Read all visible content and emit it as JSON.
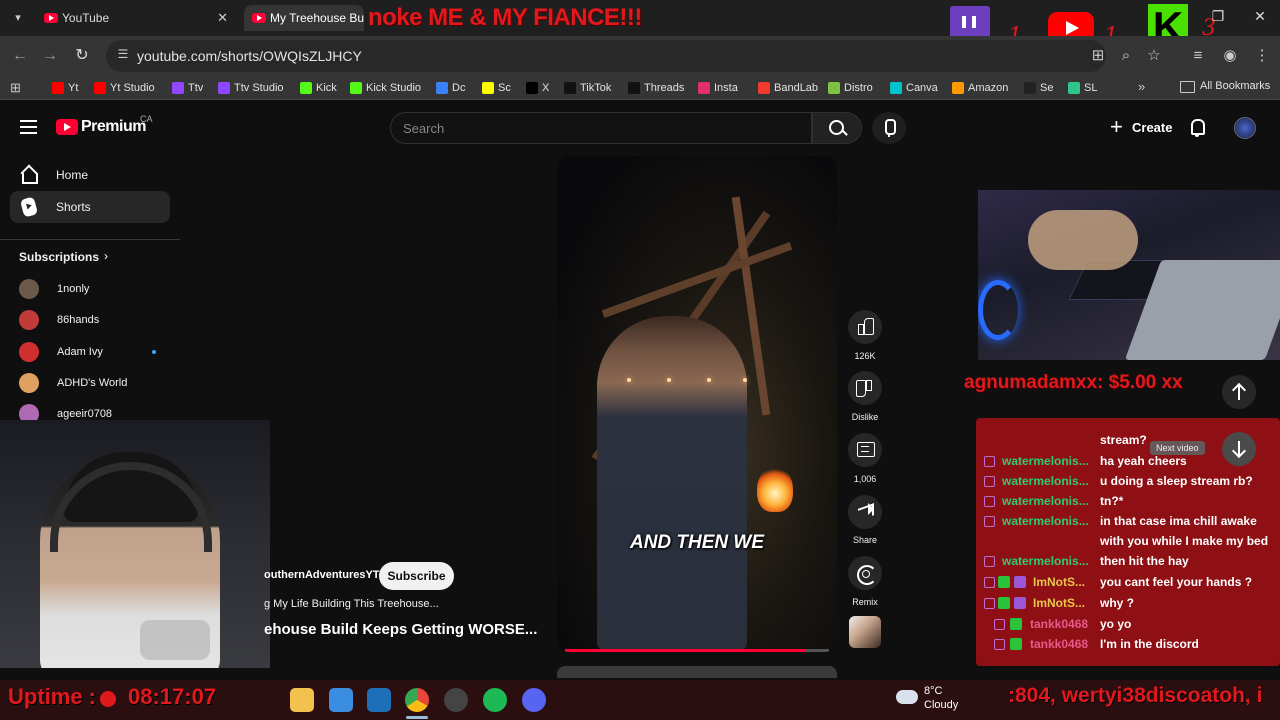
{
  "browser": {
    "tabs": [
      {
        "label": "YouTube"
      },
      {
        "label": "My Treehouse Build K"
      }
    ],
    "url": "youtube.com/shorts/OWQIsZLJHCY",
    "bookmarks": [
      {
        "label": "Yt",
        "color": "#ff0000"
      },
      {
        "label": "Yt Studio",
        "color": "#ff0000"
      },
      {
        "label": "Ttv",
        "color": "#9146ff"
      },
      {
        "label": "Ttv Studio",
        "color": "#9146ff"
      },
      {
        "label": "Kick",
        "color": "#53fc18"
      },
      {
        "label": "Kick Studio",
        "color": "#53fc18"
      },
      {
        "label": "Dc",
        "color": "#3b82f6"
      },
      {
        "label": "Sc",
        "color": "#fffc00"
      },
      {
        "label": "X",
        "color": "#000000"
      },
      {
        "label": "TikTok",
        "color": "#111111"
      },
      {
        "label": "Threads",
        "color": "#111111"
      },
      {
        "label": "Insta",
        "color": "#e1306c"
      },
      {
        "label": "BandLab",
        "color": "#f03a2e"
      },
      {
        "label": "Distro",
        "color": "#7fc241"
      },
      {
        "label": "Canva",
        "color": "#00c4cc"
      },
      {
        "label": "Amazon",
        "color": "#ff9900"
      },
      {
        "label": "Se",
        "color": "#222222"
      },
      {
        "label": "SL",
        "color": "#31c48d"
      }
    ],
    "all_bookmarks": "All Bookmarks"
  },
  "overlay": {
    "title": "noke ME & MY FIANCE!!!",
    "counts": [
      "1",
      "1",
      "3"
    ],
    "donation": "agnumadamxx: $5.00 xx",
    "uptime_label": "Uptime :",
    "uptime_value": "08:17:07",
    "ticker": ":804, wertyi38discoatoh, i"
  },
  "youtube": {
    "brand": "Premium",
    "region": "CA",
    "search_placeholder": "Search",
    "create_label": "Create",
    "sidebar": {
      "items": [
        {
          "label": "Home"
        },
        {
          "label": "Shorts"
        }
      ],
      "subscriptions_title": "Subscriptions",
      "subscriptions": [
        {
          "label": "1nonly",
          "color": "#6b5a4a"
        },
        {
          "label": "86hands",
          "color": "#c23b3b"
        },
        {
          "label": "Adam Ivy",
          "color": "#d12f2f"
        },
        {
          "label": "ADHD's World",
          "color": "#e0a060"
        },
        {
          "label": "ageeir0708",
          "color": "#b06ab3"
        }
      ]
    },
    "short": {
      "caption": "AND THEN WE",
      "progress": 0.91,
      "channel": "outhernAdventuresYT",
      "subscribe_label": "Subscribe",
      "sound": "g My Life Building This Treehouse...",
      "title": "ehouse Build Keeps Getting WORSE...",
      "actions": [
        {
          "label": "126K"
        },
        {
          "label": "Dislike"
        },
        {
          "label": "1,006"
        },
        {
          "label": "Share"
        },
        {
          "label": "Remix"
        }
      ]
    },
    "next_video_tooltip": "Next video"
  },
  "chat": {
    "top_message": "stream?",
    "messages": [
      {
        "user": "watermelonis...",
        "text": "ha yeah cheers",
        "user_color": "#2ecc71"
      },
      {
        "user": "watermelonis...",
        "text": "u doing a sleep stream rb?",
        "user_color": "#2ecc71"
      },
      {
        "user": "watermelonis...",
        "text": "tn?*",
        "user_color": "#2ecc71"
      },
      {
        "user": "watermelonis...",
        "text": "in that case ima chill awake",
        "user_color": "#2ecc71"
      },
      {
        "user": "",
        "text": "with you while I make my bed",
        "user_color": "#2ecc71"
      },
      {
        "user": "watermelonis...",
        "text": "then hit the hay",
        "user_color": "#2ecc71"
      },
      {
        "user": "ImNotS...",
        "text": "you cant feel your hands ?",
        "user_color": "#e8c64a"
      },
      {
        "user": "ImNotS...",
        "text": "why ?",
        "user_color": "#e8c64a"
      },
      {
        "user": "tankk0468",
        "text": "yo yo",
        "user_color": "#e85a8a"
      },
      {
        "user": "tankk0468",
        "text": "I'm in the discord",
        "user_color": "#e85a8a"
      }
    ]
  },
  "taskbar": {
    "apps": [
      {
        "name": "file-explorer-icon",
        "color": "#f2c14e"
      },
      {
        "name": "store-icon",
        "color": "#3a8de0"
      },
      {
        "name": "app-icon",
        "color": "#1e6fb8"
      },
      {
        "name": "chrome-icon",
        "color": "#e8453c"
      },
      {
        "name": "obs-icon",
        "color": "#444444"
      },
      {
        "name": "spotify-icon",
        "color": "#1db954"
      },
      {
        "name": "discord-icon",
        "color": "#5865f2"
      }
    ],
    "weather_temp": "8°C",
    "weather_cond": "Cloudy"
  }
}
